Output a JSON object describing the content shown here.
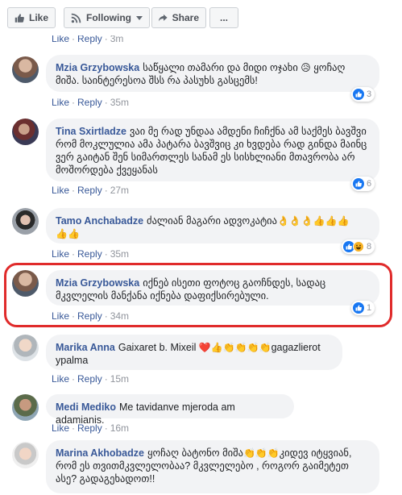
{
  "topbar": {
    "like_label": "Like",
    "following_label": "Following",
    "share_label": "Share",
    "more_label": "..."
  },
  "prev_actions": {
    "like": "Like",
    "reply": "Reply",
    "dot": "·",
    "time": "3m"
  },
  "comments": [
    {
      "author": "Mzia Grzybowska",
      "text_parts": [
        "საწყალი თამარი და მიდი ოჯახი ",
        " ყოჩაღ მიშა. საინტერესოა შსს რა პასუხს გასცემს!"
      ],
      "emoji": "😥",
      "reactions": "3",
      "like": "Like",
      "reply": "Reply",
      "time": "35m"
    },
    {
      "author": "Tina Sxirtladze",
      "text": "ვაი მე რად უნდაა ამდენი ჩიჩქნა ამ საქმეს ბავშვი რომ მოკლულია ამა პატარა ბავშვიც კი ხვდება რად გინდა მაინც ვერ გაიტან შენ სიმართლეს სანამ ეს სისხლიანი მთავრობა არ მოშორდება ქვეყანას",
      "reactions": "6",
      "like": "Like",
      "reply": "Reply",
      "time": "27m"
    },
    {
      "author": "Tamo Anchabadze",
      "text": "ძალიან მაგარი ადვოკატია",
      "emoji_line1": "👌👌👌👍👍👍",
      "emoji_line2": "👍👍",
      "reactions": "8",
      "like": "Like",
      "reply": "Reply",
      "time": "35m"
    },
    {
      "author": "Mzia Grzybowska",
      "text": "იქნებ ისეთი ფოტოც გაოჩნდეს, სადაც მკვლელის მანქანა იქნება დაფიქსირებული.",
      "reactions": "1",
      "like": "Like",
      "reply": "Reply",
      "time": "34m"
    },
    {
      "author": "Marika Anna",
      "text_a": "Gaixaret b. Mixeil ",
      "emoji": "❤️👍👏👏👏👏",
      "text_b": "gagazlierot ypalma",
      "like": "Like",
      "reply": "Reply",
      "time": "15m"
    },
    {
      "author": "Medi Mediko",
      "text": "Me tavidanve mjeroda am adamianis.",
      "like": "Like",
      "reply": "Reply",
      "time": "16m"
    },
    {
      "author": "Marina Akhobadze",
      "text_a": "ყოჩაღ ბატონო მიშა",
      "emoji": "👏👏👏",
      "text_b": "კიდევ იტყვიან, რომ ეს თვითმკვლელობაა? მკვლელებო , როგორ გაიმეტეთ ასე? გადაგეხადოთ!!"
    }
  ],
  "colors": {
    "link": "#385898",
    "bubble": "#f2f3f5",
    "highlight": "#e02b2b",
    "like_badge": "#1877f2"
  }
}
